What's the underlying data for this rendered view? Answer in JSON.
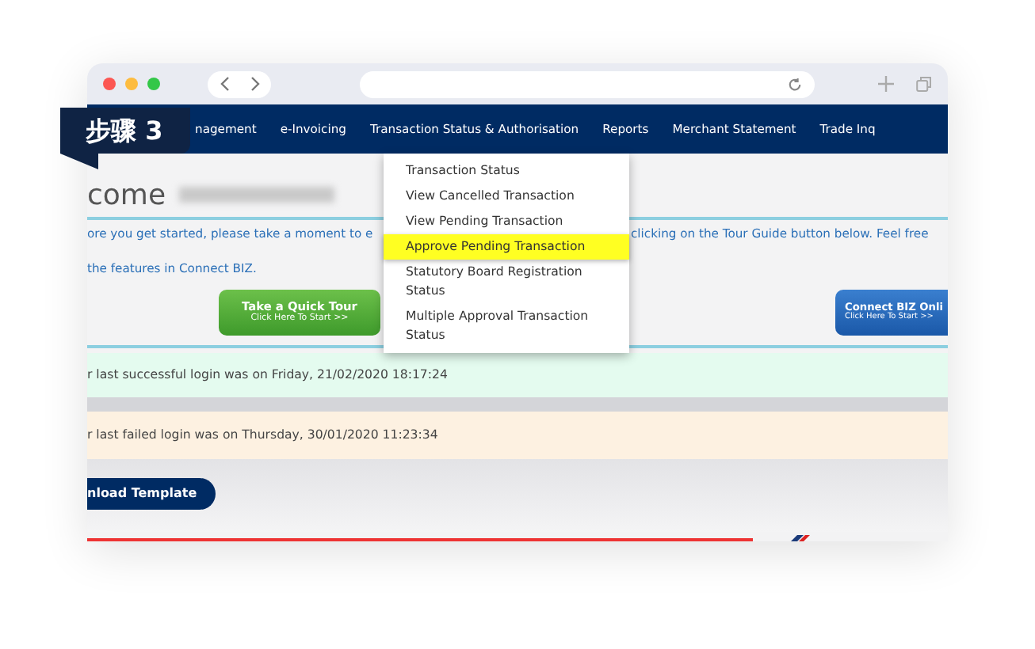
{
  "step_badge": {
    "label": "步骤 3"
  },
  "nav": [
    {
      "label": "nagement"
    },
    {
      "label": "e-Invoicing"
    },
    {
      "label": "Transaction Status & Authorisation"
    },
    {
      "label": "Reports"
    },
    {
      "label": "Merchant Statement"
    },
    {
      "label": "Trade Inq"
    }
  ],
  "dropdown": [
    {
      "label": "Transaction Status",
      "selected": false
    },
    {
      "label": "View Cancelled Transaction",
      "selected": false
    },
    {
      "label": "View Pending Transaction",
      "selected": false
    },
    {
      "label": "Approve Pending Transaction",
      "selected": true
    },
    {
      "label": "Statutory Board Registration Status",
      "selected": false
    },
    {
      "label": "Multiple Approval Transaction Status",
      "selected": false
    }
  ],
  "welcome": {
    "heading": "come"
  },
  "intro": {
    "line_1_left": "ore you get started, please take a moment to e",
    "line_1_right": "clicking on the Tour Guide button below. Feel free",
    "line_2": "the features in Connect BIZ."
  },
  "tour_buttons": [
    {
      "kind": "green",
      "title": "Take a Quick Tour",
      "subtitle": "Click Here To Start >>"
    },
    {
      "kind": "blue",
      "title": "Connect BIZ Onli",
      "subtitle": "Click Here To Start >>"
    }
  ],
  "login_notices": [
    {
      "kind": "success",
      "text": "r last successful login was on Friday, 21/02/2020 18:17:24"
    },
    {
      "kind": "failed",
      "text": "r last failed login was on Thursday, 30/01/2020 11:23:34"
    }
  ],
  "download_button": {
    "label": "nload Template"
  }
}
